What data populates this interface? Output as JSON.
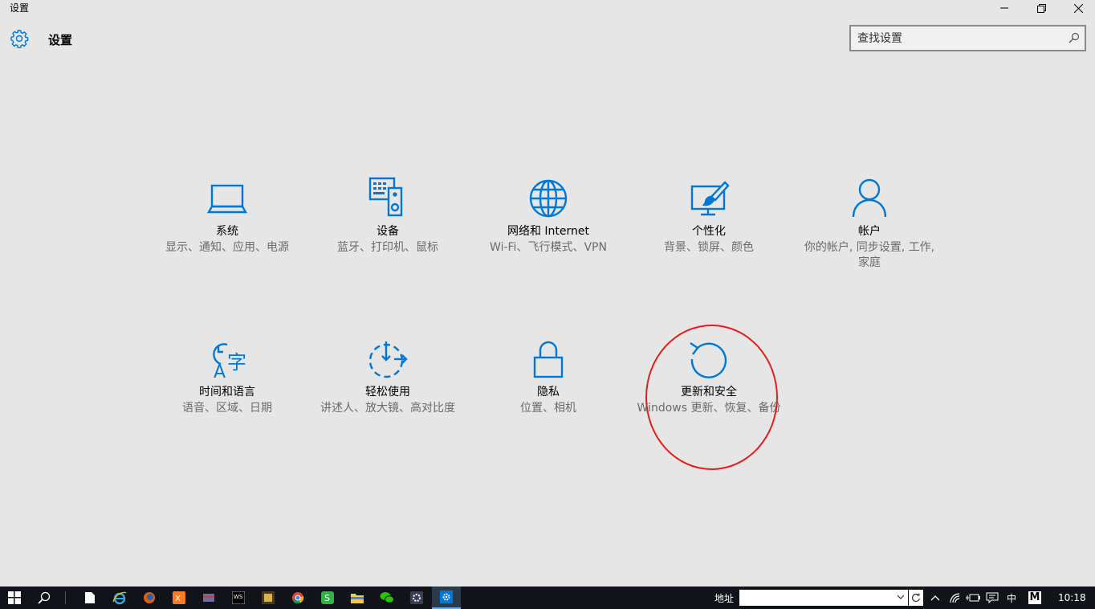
{
  "window": {
    "title": "设置",
    "minimize_icon": "minimize-icon",
    "restore_icon": "restore-icon",
    "close_icon": "close-icon"
  },
  "header": {
    "icon": "gear-icon",
    "title": "设置",
    "search_placeholder": "查找设置"
  },
  "accent_color": "#0078d7",
  "annotation_color": "#e41d1d",
  "tiles": [
    {
      "title": "系统",
      "desc": "显示、通知、应用、电源",
      "icon": "laptop-icon"
    },
    {
      "title": "设备",
      "desc": "蓝牙、打印机、鼠标",
      "icon": "devices-icon"
    },
    {
      "title": "网络和 Internet",
      "desc": "Wi-Fi、飞行模式、VPN",
      "icon": "globe-icon"
    },
    {
      "title": "个性化",
      "desc": "背景、锁屏、颜色",
      "icon": "personalization-icon"
    },
    {
      "title": "帐户",
      "desc": "你的帐户, 同步设置, 工作, 家庭",
      "icon": "person-icon"
    },
    {
      "title": "时间和语言",
      "desc": "语音、区域、日期",
      "icon": "time-language-icon"
    },
    {
      "title": "轻松使用",
      "desc": "讲述人、放大镜、高对比度",
      "icon": "ease-of-access-icon"
    },
    {
      "title": "隐私",
      "desc": "位置、相机",
      "icon": "lock-icon"
    },
    {
      "title": "更新和安全",
      "desc": "Windows 更新、恢复、备份",
      "icon": "refresh-icon"
    }
  ],
  "taskbar": {
    "address_label": "地址",
    "address_value": "",
    "ime": "中",
    "ime_mode": "M",
    "clock": "10:18"
  }
}
